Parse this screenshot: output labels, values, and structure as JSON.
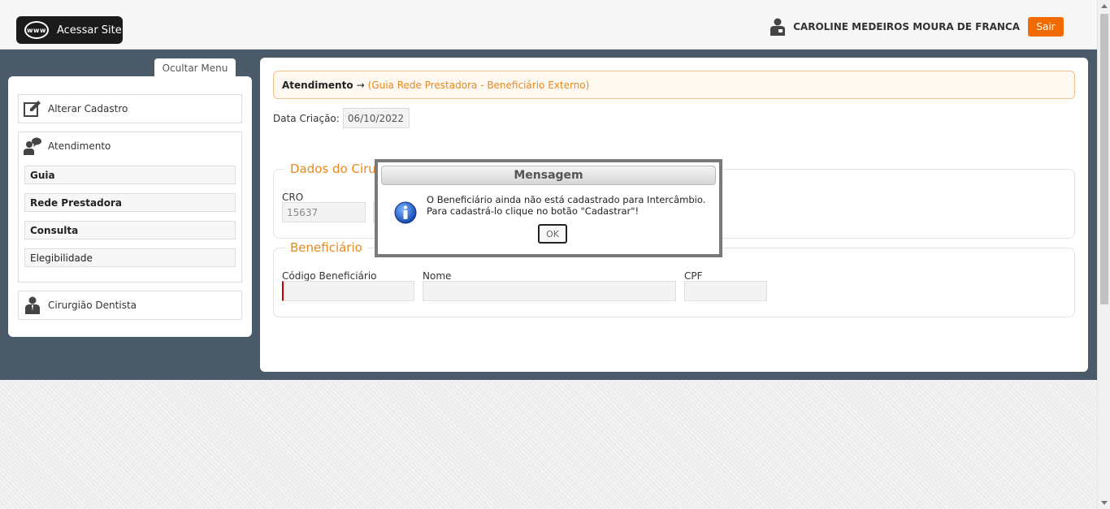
{
  "header": {
    "site_button_label": "Acessar Site",
    "www_label": "www",
    "user_name": "CAROLINE MEDEIROS MOURA DE FRANCA",
    "logout_label": "Sair"
  },
  "sidebar": {
    "hide_menu_label": "Ocultar Menu",
    "alter_label": "Alterar Cadastro",
    "group_label": "Atendimento",
    "sub_items": [
      {
        "label": "Guia"
      },
      {
        "label": "Rede Prestadora"
      },
      {
        "label": "Consulta"
      },
      {
        "label": "Elegibilidade"
      }
    ],
    "dentist_label": "Cirurgião Dentista"
  },
  "main": {
    "breadcrumb_main": "Atendimento",
    "breadcrumb_arrow": "→",
    "breadcrumb_sub": "(Guia Rede Prestadora - Beneficiário Externo)",
    "date_label": "Data Criação:",
    "date_value": "06/10/2022",
    "section1_title": "Dados do Cirur",
    "cro_label": "CRO",
    "cro_value": "15637",
    "section2_title": "Beneficiário",
    "code_label": "Código Beneficiário",
    "code_value": "",
    "name_label": "Nome",
    "name_value": "",
    "cpf_label": "CPF",
    "cpf_value": ""
  },
  "modal": {
    "title": "Mensagem",
    "line1": "O Beneficiário ainda não está cadastrado para Intercâmbio.",
    "line2": "Para cadastrá-lo clique no botão \"Cadastrar\"!",
    "ok_label": "OK"
  },
  "colors": {
    "accent_orange": "#e8891e",
    "logout_orange": "#f26b00",
    "dark_band": "#4a5a68"
  }
}
